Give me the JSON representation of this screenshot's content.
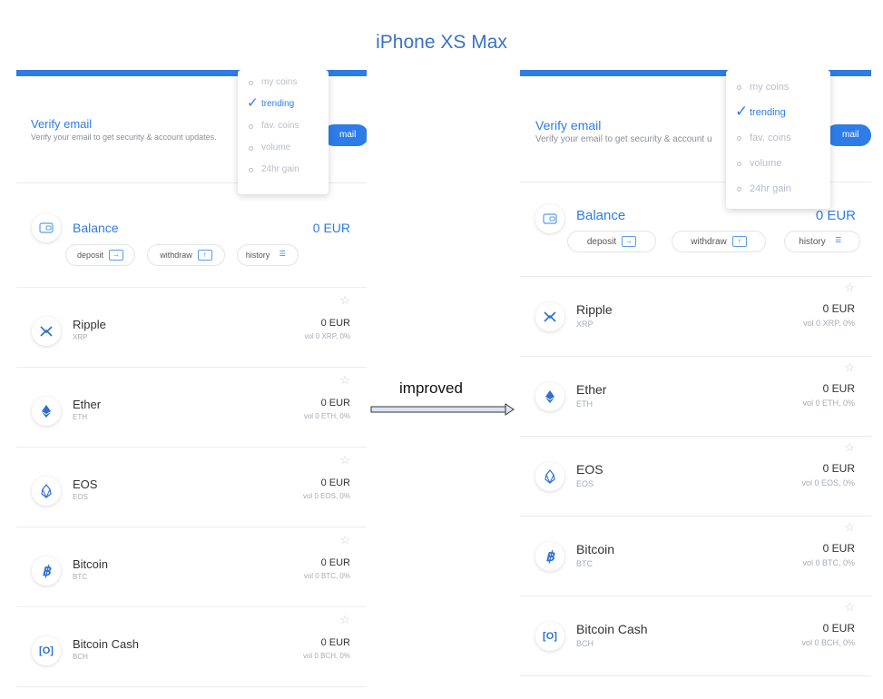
{
  "page_title": "iPhone XS Max",
  "arrow_label": "improved",
  "colors": {
    "accent": "#2e7ce8",
    "title": "#3a72c4",
    "muted": "#a6abb3"
  },
  "verify": {
    "title": "Verify email",
    "subtitle_left": "Verify your email to get security & account updates.",
    "subtitle_right": "Verify your email to get security & account u",
    "button_fragment": "mail"
  },
  "dropdown": {
    "options": [
      {
        "label": "my coins",
        "active": false
      },
      {
        "label": "trending",
        "active": true
      },
      {
        "label": "fav. coins",
        "active": false
      },
      {
        "label": "volume",
        "active": false
      },
      {
        "label": "24hr gain",
        "active": false
      }
    ]
  },
  "balance": {
    "label": "Balance",
    "value": "0 EUR",
    "deposit": "deposit",
    "withdraw": "withdraw",
    "history": "history",
    "icon": "wallet-icon"
  },
  "coins": [
    {
      "name": "Ripple",
      "symbol": "XRP",
      "value": "0 EUR",
      "vol": "vol 0 XRP, 0%",
      "icon": "ripple-icon"
    },
    {
      "name": "Ether",
      "symbol": "ETH",
      "value": "0 EUR",
      "vol": "vol 0 ETH, 0%",
      "icon": "ether-icon"
    },
    {
      "name": "EOS",
      "symbol": "EOS",
      "value": "0 EUR",
      "vol": "vol 0 EOS, 0%",
      "icon": "eos-icon"
    },
    {
      "name": "Bitcoin",
      "symbol": "BTC",
      "value": "0 EUR",
      "vol": "vol 0 BTC, 0%",
      "icon": "bitcoin-icon"
    },
    {
      "name": "Bitcoin Cash",
      "symbol": "BCH",
      "value": "0 EUR",
      "vol": "vol 0 BCH, 0%",
      "icon": "bitcoin-cash-icon"
    }
  ]
}
